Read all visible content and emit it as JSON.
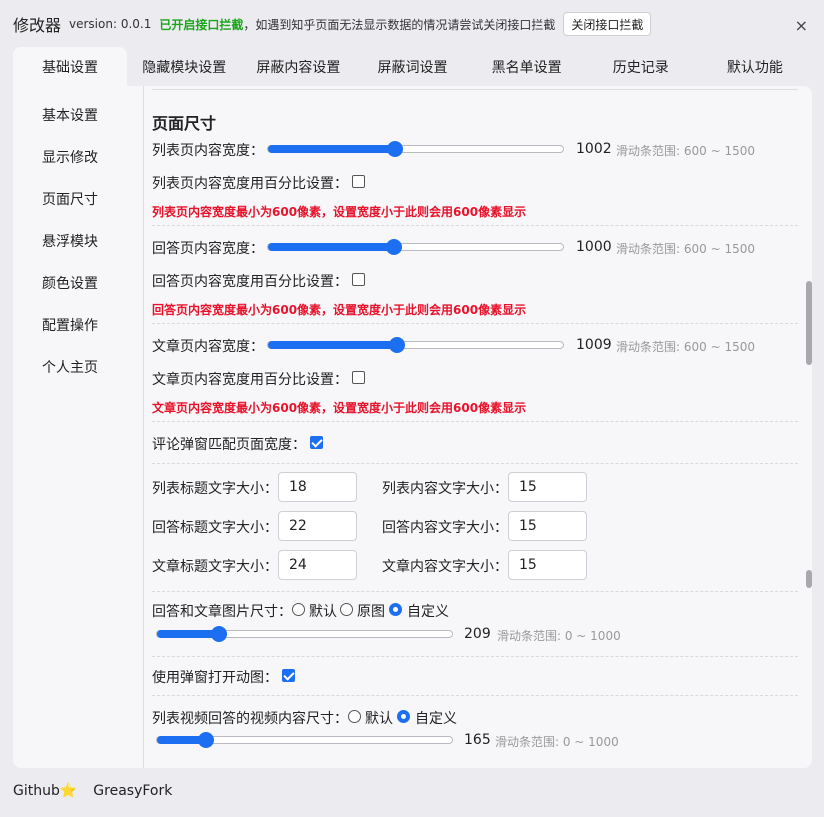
{
  "header": {
    "app_title": "修改器",
    "version": "version: 0.0.1",
    "notice_green": "已开启接口拦截",
    "notice_rest": "，如遇到知乎页面无法显示数据的情况请尝试关闭接口拦截",
    "close_intercept_label": "关闭接口拦截",
    "close_symbol": "×"
  },
  "tabs": [
    "基础设置",
    "隐藏模块设置",
    "屏蔽内容设置",
    "屏蔽词设置",
    "黑名单设置",
    "历史记录",
    "默认功能"
  ],
  "sidebar": [
    "基本设置",
    "显示修改",
    "页面尺寸",
    "悬浮模块",
    "颜色设置",
    "配置操作",
    "个人主页"
  ],
  "content": {
    "section_title": "页面尺寸",
    "list_width": {
      "label": "列表页内容宽度：",
      "value": "1002",
      "fraction": 0.431,
      "hint": "滑动条范围: 600 ~ 1500",
      "percent_label": "列表页内容宽度用百分比设置：",
      "warning": "列表页内容宽度最小为600像素，设置宽度小于此则会用600像素显示"
    },
    "answer_width": {
      "label": "回答页内容宽度：",
      "value": "1000",
      "fraction": 0.428,
      "hint": "滑动条范围: 600 ~ 1500",
      "percent_label": "回答页内容宽度用百分比设置：",
      "warning": "回答页内容宽度最小为600像素，设置宽度小于此则会用600像素显示"
    },
    "article_width": {
      "label": "文章页内容宽度：",
      "value": "1009",
      "fraction": 0.436,
      "hint": "滑动条范围: 600 ~ 1500",
      "percent_label": "文章页内容宽度用百分比设置：",
      "warning": "文章页内容宽度最小为600像素，设置宽度小于此则会用600像素显示"
    },
    "comment_match_label": "评论弹窗匹配页面宽度：",
    "font_sizes": {
      "list_title_label": "列表标题文字大小：",
      "list_title_value": "18",
      "list_content_label": "列表内容文字大小：",
      "list_content_value": "15",
      "answer_title_label": "回答标题文字大小：",
      "answer_title_value": "22",
      "answer_content_label": "回答内容文字大小：",
      "answer_content_value": "15",
      "article_title_label": "文章标题文字大小：",
      "article_title_value": "24",
      "article_content_label": "文章内容文字大小：",
      "article_content_value": "15"
    },
    "image_size": {
      "label": "回答和文章图片尺寸：",
      "opt_default": "默认",
      "opt_original": "原图",
      "opt_custom": "自定义",
      "selected": "自定义",
      "value": "209",
      "fraction": 0.209,
      "hint": "滑动条范围: 0 ~ 1000"
    },
    "popup_gif_label": "使用弹窗打开动图：",
    "video_size": {
      "label": "列表视频回答的视频内容尺寸：",
      "opt_default": "默认",
      "opt_custom": "自定义",
      "selected": "自定义",
      "value": "165",
      "fraction": 0.165,
      "hint": "滑动条范围: 0 ~ 1000"
    }
  },
  "footer": {
    "github": "Github⭐",
    "greasyfork": "GreasyFork"
  },
  "colors": {
    "accent": "#1d6ff2",
    "warning": "#e8122a",
    "notice_green": "#1aa51a"
  }
}
